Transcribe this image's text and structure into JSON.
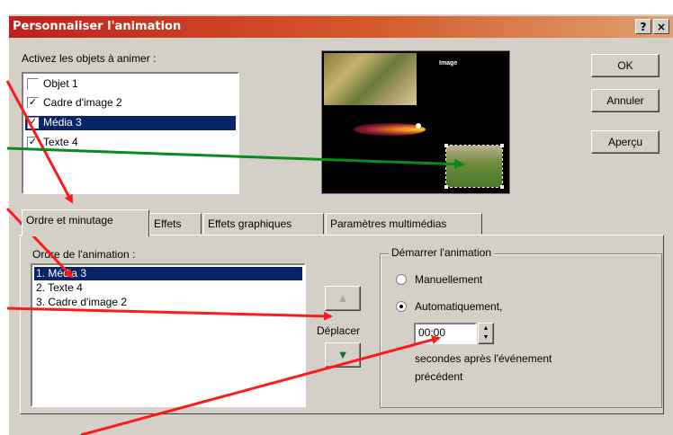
{
  "window": {
    "title": "Personnaliser l'animation",
    "help_label": "?",
    "close_label": "×"
  },
  "objects": {
    "label": "Activez les objets à animer :",
    "items": [
      {
        "label": "Objet 1",
        "checked": false
      },
      {
        "label": "Cadre d'image 2",
        "checked": true
      },
      {
        "label": "Média 3",
        "checked": true,
        "selected": true
      },
      {
        "label": "Texte 4",
        "checked": true
      }
    ]
  },
  "preview": {
    "caption": "Image"
  },
  "buttons": {
    "ok": "OK",
    "cancel": "Annuler",
    "preview": "Aperçu"
  },
  "tabs": [
    {
      "label": "Ordre et minutage",
      "active": true
    },
    {
      "label": "Effets",
      "active": false
    },
    {
      "label": "Effets graphiques",
      "active": false
    },
    {
      "label": "Paramètres multimédias",
      "active": false
    }
  ],
  "order": {
    "label": "Ordre de l'animation :",
    "items": [
      "1. Média 3",
      "2. Texte 4",
      "3. Cadre d'image 2"
    ],
    "move_label": "Déplacer"
  },
  "start": {
    "group_label": "Démarrer l'animation",
    "manual": "Manuellement",
    "automatic": "Automatiquement,",
    "time_value": "00:00",
    "after_text_1": "secondes après l'événement",
    "after_text_2": "précédent"
  },
  "colors": {
    "arrow_red": "#ff1a1a",
    "arrow_green": "#0a8a1a",
    "selection": "#0a246a"
  }
}
